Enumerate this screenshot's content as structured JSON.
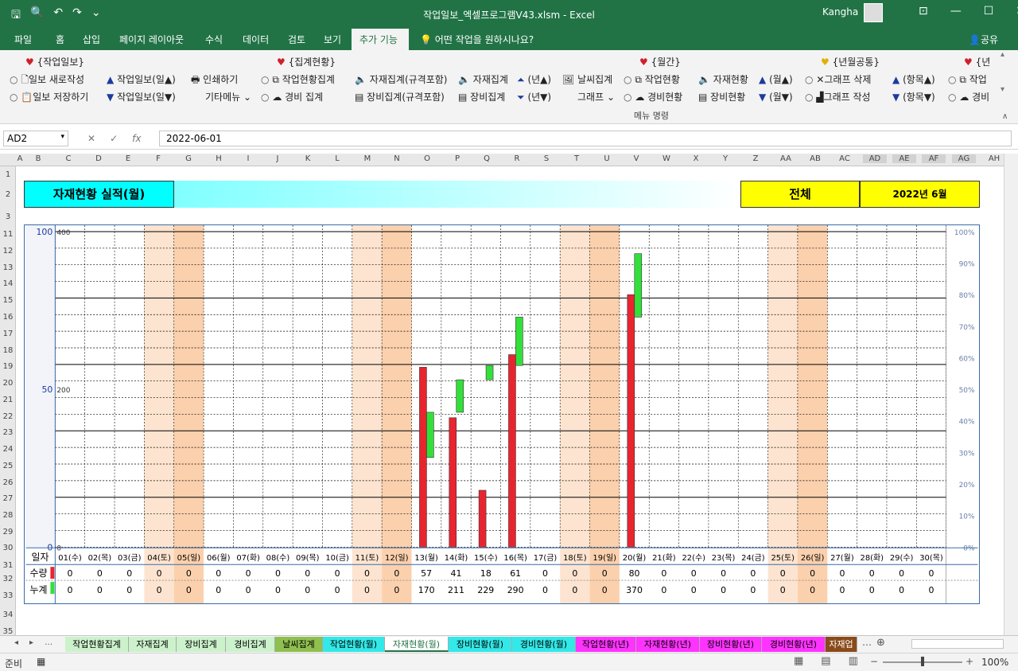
{
  "window": {
    "title": "작업일보_엑셀프로그램V43.xlsm  -  Excel",
    "user": "Kangha"
  },
  "menu": [
    "파일",
    "홈",
    "삽입",
    "페이지 레이아웃",
    "수식",
    "데이터",
    "검토",
    "보기",
    "추가 기능"
  ],
  "tell_me": "어떤 작업을 원하시나요?",
  "share": "공유",
  "ribbon": {
    "g1_title": "{작업일보}",
    "g1_items": [
      "일보 새로작성",
      "일보 저장하기",
      "작업일보(일▲)",
      "작업일보(일▼)",
      "인쇄하기",
      "기타메뉴"
    ],
    "g2_title": "{집계현황}",
    "g2_items": [
      "작업현황집계",
      "경비 집계",
      "자재집계(규격포함)",
      "장비집계(규격포함)",
      "자재집계",
      "장비집계",
      "(년▲)",
      "(년▼)",
      "날씨집계",
      "그래프"
    ],
    "g3_title": "{월간}",
    "g3_items": [
      "작업현황",
      "경비현황",
      "자재현황",
      "장비현황",
      "(월▲)",
      "(월▼)"
    ],
    "g4_title": "{년월공통}",
    "g4_items": [
      "그래프 삭제",
      "그래프 작성",
      "(항목▲)",
      "(항목▼)"
    ],
    "g5_title": "{년",
    "g5_items": [
      "작업",
      "경비"
    ],
    "group_label": "메뉴 명령"
  },
  "formula_bar": {
    "name_box": "AD2",
    "formula": "2022-06-01"
  },
  "columns": [
    "A",
    "B",
    "C",
    "D",
    "E",
    "F",
    "G",
    "H",
    "I",
    "J",
    "K",
    "L",
    "M",
    "N",
    "O",
    "P",
    "Q",
    "R",
    "S",
    "T",
    "U",
    "V",
    "W",
    "X",
    "Y",
    "Z",
    "AA",
    "AB",
    "AC",
    "AD",
    "AE",
    "AF",
    "AG",
    "AH"
  ],
  "rows": [
    "1",
    "2",
    "3",
    "11",
    "12",
    "13",
    "14",
    "15",
    "16",
    "17",
    "18",
    "19",
    "20",
    "21",
    "22",
    "23",
    "24",
    "25",
    "26",
    "27",
    "28",
    "29",
    "30",
    "31",
    "32",
    "33",
    "34",
    "35"
  ],
  "sheet": {
    "title": "자재현황 실적(월)",
    "scope": "전체",
    "month": "2022년 6월"
  },
  "table": {
    "date_label": "일자",
    "qty_label": "수량",
    "cum_label": "누계"
  },
  "chart_data": {
    "type": "bar",
    "left_axis_ticks": [
      "100",
      "50",
      "0"
    ],
    "count_axis_ticks": [
      "400",
      "200",
      "0"
    ],
    "pct_axis_ticks": [
      "100%",
      "90%",
      "80%",
      "70%",
      "60%",
      "50%",
      "40%",
      "30%",
      "20%",
      "10%",
      "0%"
    ],
    "left_axis_range": [
      0,
      100
    ],
    "count_axis_range": [
      0,
      400
    ],
    "pct_axis_range": [
      0,
      100
    ],
    "categories": [
      "01(수)",
      "02(목)",
      "03(금)",
      "04(토)",
      "05(일)",
      "06(월)",
      "07(화)",
      "08(수)",
      "09(목)",
      "10(금)",
      "11(토)",
      "12(일)",
      "13(월)",
      "14(화)",
      "15(수)",
      "16(목)",
      "17(금)",
      "18(토)",
      "19(일)",
      "20(월)",
      "21(화)",
      "22(수)",
      "23(목)",
      "24(금)",
      "25(토)",
      "26(일)",
      "27(월)",
      "28(화)",
      "29(수)",
      "30(목)"
    ],
    "series": [
      {
        "name": "수량",
        "color": "#e8252f",
        "values": [
          0,
          0,
          0,
          0,
          0,
          0,
          0,
          0,
          0,
          0,
          0,
          0,
          57,
          41,
          18,
          61,
          0,
          0,
          0,
          80,
          0,
          0,
          0,
          0,
          0,
          0,
          0,
          0,
          0,
          0
        ]
      },
      {
        "name": "누계",
        "color": "#33e03a",
        "values": [
          0,
          0,
          0,
          0,
          0,
          0,
          0,
          0,
          0,
          0,
          0,
          0,
          170,
          211,
          229,
          290,
          0,
          0,
          0,
          370,
          0,
          0,
          0,
          0,
          0,
          0,
          0,
          0,
          0,
          0
        ]
      }
    ],
    "weekend": [
      "sat",
      "sun"
    ],
    "weekend_colors": {
      "sat": "#fde4d0",
      "sun": "#fbd0ad"
    }
  },
  "sheet_tabs": [
    {
      "label": "작업현황집계",
      "color": "#ccf2cc"
    },
    {
      "label": "자재집계",
      "color": "#ccf2cc"
    },
    {
      "label": "장비집계",
      "color": "#ccf2cc"
    },
    {
      "label": "경비집계",
      "color": "#ccf2cc"
    },
    {
      "label": "날씨집계",
      "color": "#8fbf4f"
    },
    {
      "label": "작업현황(월)",
      "color": "#33e8e8"
    },
    {
      "label": "자재현황(월)",
      "color": "#ffffff"
    },
    {
      "label": "장비현황(월)",
      "color": "#33e8e8"
    },
    {
      "label": "경비현황(월)",
      "color": "#33e8e8"
    },
    {
      "label": "작업현황(년)",
      "color": "#ff33ff"
    },
    {
      "label": "자재현황(년)",
      "color": "#ff33ff"
    },
    {
      "label": "장비현황(년)",
      "color": "#ff33ff"
    },
    {
      "label": "경비현황(년)",
      "color": "#ff33ff"
    },
    {
      "label": "자재업",
      "color": "#8a4a1a"
    }
  ],
  "status": {
    "ready": "준비",
    "zoom": "100%"
  }
}
